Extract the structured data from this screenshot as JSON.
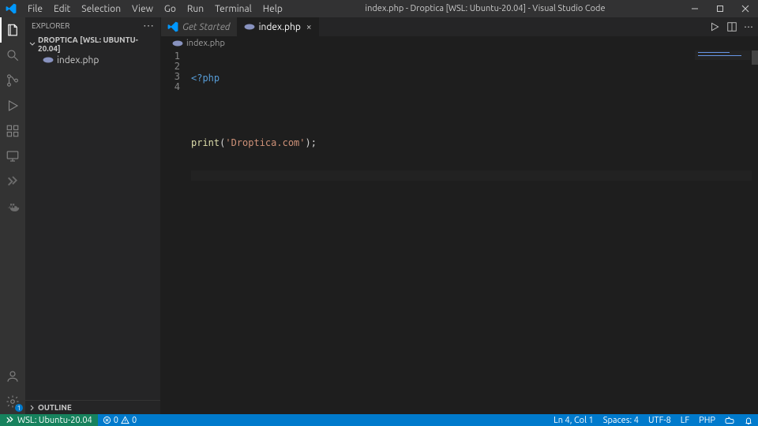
{
  "menu": [
    "File",
    "Edit",
    "Selection",
    "View",
    "Go",
    "Run",
    "Terminal",
    "Help"
  ],
  "window_title": "index.php - Droptica [WSL: Ubuntu-20.04] - Visual Studio Code",
  "explorer": {
    "title": "EXPLORER",
    "root": "DROPTICA [WSL: UBUNTU-20.04]",
    "files": [
      "index.php"
    ],
    "outline": "OUTLINE"
  },
  "tabs": {
    "inactive": "Get Started",
    "active": "index.php"
  },
  "breadcrumb": "index.php",
  "code": {
    "lines": [
      "1",
      "2",
      "3",
      "4"
    ],
    "l1_tag": "<?php",
    "l3_fn": "print",
    "l3_open": "(",
    "l3_str": "'Droptica.com'",
    "l3_close": ");"
  },
  "status": {
    "remote": "WSL: Ubuntu-20.04",
    "errors": "0",
    "warnings": "0",
    "lncol": "Ln 4, Col 1",
    "spaces": "Spaces: 4",
    "encoding": "UTF-8",
    "eol": "LF",
    "lang": "PHP"
  },
  "settings_badge": "1"
}
